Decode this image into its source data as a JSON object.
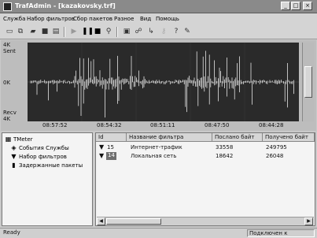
{
  "window": {
    "title": "TrafAdmin - [kazakovsky.trf]"
  },
  "window_controls": {
    "minimize": "_",
    "maximize": "□",
    "close": "×"
  },
  "menu": [
    "Служба",
    "Набор фильтров",
    "Сбор пакетов",
    "Разное",
    "Вид",
    "Помощь"
  ],
  "toolbar": [
    "new-icon",
    "clone-icon",
    "open-icon",
    "save-icon",
    "properties-icon",
    "play-icon",
    "pause-icon",
    "stop-icon",
    "filter-icon",
    "monitor-icon",
    "network-icon",
    "connect-icon",
    "key-icon",
    "help-icon",
    "about-icon"
  ],
  "graph": {
    "y_top": "4K",
    "y_top_sub": "Sent",
    "y_mid": "0K",
    "y_bottom_sub": "Recv",
    "y_bottom": "4K",
    "x_ticks": [
      "08:57:52",
      "08:54:32",
      "08:51:11",
      "08:47:50",
      "08:44:28"
    ],
    "colors": {
      "background": "#2a2a2a",
      "trace": "#ffffff",
      "grid": "#3a3a3a"
    }
  },
  "tree": {
    "items": [
      {
        "label": "TMeter",
        "icon": "tmeter-icon"
      },
      {
        "label": "События Службы",
        "icon": "events-icon"
      },
      {
        "label": "Набор фильтров",
        "icon": "filter-icon"
      },
      {
        "label": "Задержанные пакеты",
        "icon": "packets-icon"
      }
    ]
  },
  "table": {
    "headers": [
      "Id",
      "Название фильтра",
      "Послано байт",
      "Получено байт"
    ],
    "rows": [
      {
        "id": "15",
        "name": "Интернет-трафик",
        "sent": "33558",
        "received": "249795",
        "selected": false
      },
      {
        "id": "14",
        "name": "Локальная сеть",
        "sent": "18642",
        "received": "26048",
        "selected": true
      }
    ]
  },
  "status": {
    "left": "Ready",
    "right": "Подключен к"
  }
}
